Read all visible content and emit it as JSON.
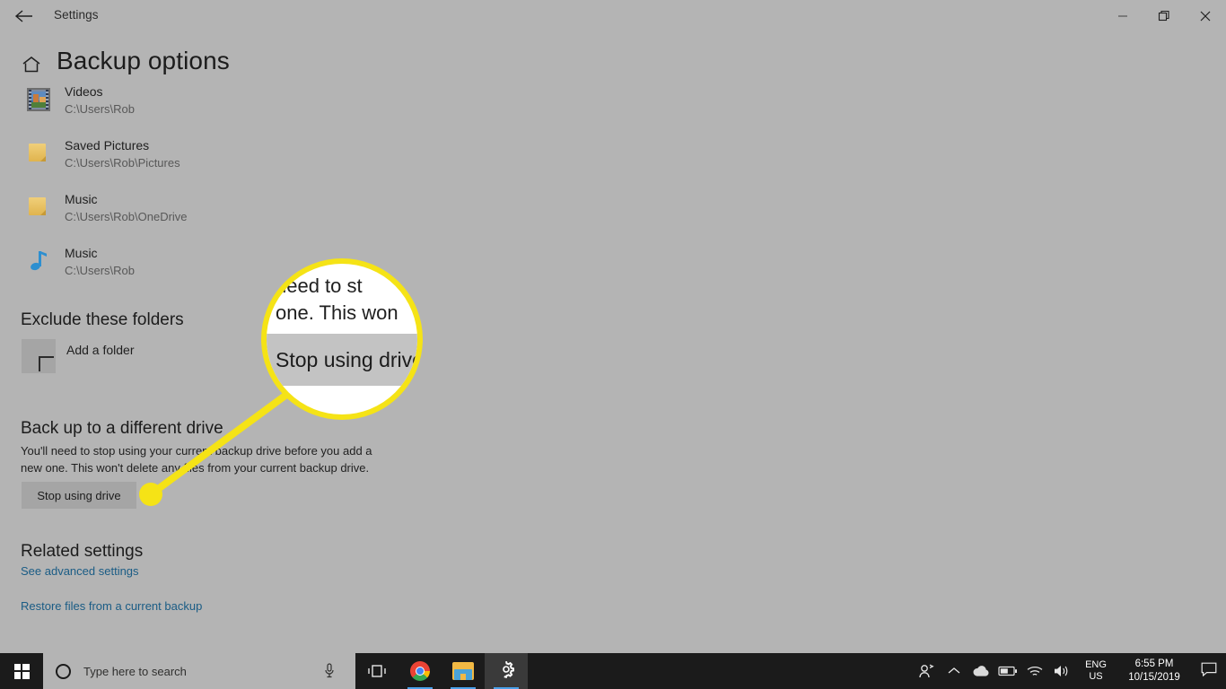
{
  "window": {
    "title": "Settings",
    "back_icon": "back-arrow-icon",
    "minimize_label": "Minimize",
    "restore_label": "Restore",
    "close_label": "Close"
  },
  "page": {
    "home_icon": "home-icon",
    "title": "Backup options"
  },
  "folders": [
    {
      "icon": "film-strip-icon",
      "name": "Videos",
      "path": "C:\\Users\\Rob"
    },
    {
      "icon": "folder-icon",
      "name": "Saved Pictures",
      "path": "C:\\Users\\Rob\\Pictures"
    },
    {
      "icon": "folder-icon",
      "name": "Music",
      "path": "C:\\Users\\Rob\\OneDrive"
    },
    {
      "icon": "music-note-icon",
      "name": "Music",
      "path": "C:\\Users\\Rob"
    }
  ],
  "exclude_section": {
    "heading": "Exclude these folders",
    "add_icon": "plus-icon",
    "add_label": "Add a folder"
  },
  "different_drive_section": {
    "heading": "Back up to a different drive",
    "body_line1": "You'll need to stop using your current backup drive before you add a",
    "body_line2": "new one. This won't delete any files from your current backup drive.",
    "button_label": "Stop using drive"
  },
  "related_section": {
    "heading": "Related settings",
    "link_advanced": "See advanced settings",
    "link_restore": "Restore files from a current backup"
  },
  "callout": {
    "magnified_line1": "need to st",
    "magnified_line2": "w one. This won",
    "magnified_button": "Stop using drive",
    "ring_color": "#f5e316",
    "dot_color": "#f5e316"
  },
  "taskbar": {
    "start_label": "Start",
    "search_placeholder": "Type here to search",
    "search_icon": "search-circle-icon",
    "mic_icon": "microphone-icon",
    "taskview_label": "Task View",
    "chrome_label": "Google Chrome",
    "explorer_label": "File Explorer",
    "settings_label": "Settings",
    "tray": {
      "people_icon": "people-icon",
      "show_hidden_icon": "chevron-up-icon",
      "onedrive_icon": "cloud-icon",
      "battery_icon": "battery-icon",
      "network_icon": "wifi-icon",
      "volume_icon": "speaker-icon",
      "language_line1": "ENG",
      "language_line2": "US",
      "time": "6:55 PM",
      "date": "10/15/2019",
      "action_center_icon": "action-center-icon"
    }
  }
}
